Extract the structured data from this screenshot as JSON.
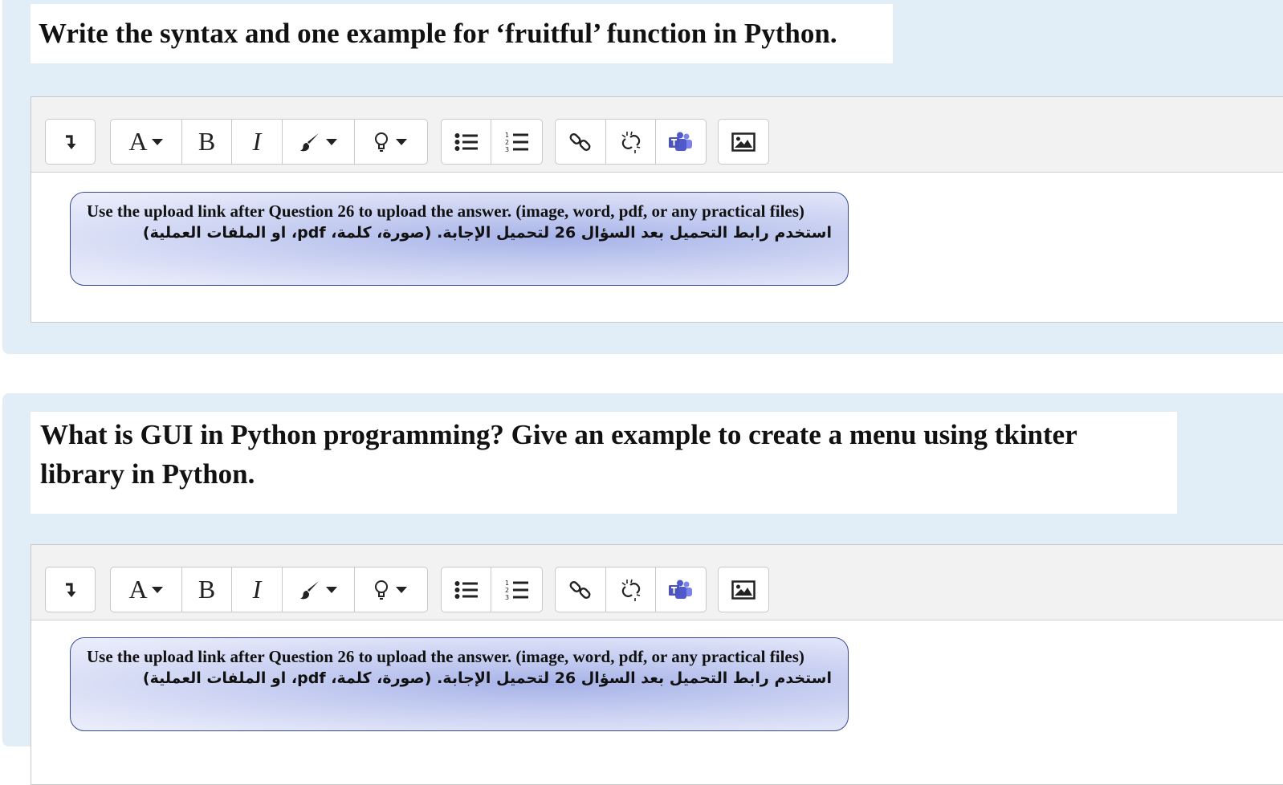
{
  "questions": [
    {
      "text": "Write the syntax and one example for ‘fruitful’ function in Python.",
      "notice": {
        "english": "Use the upload link after Question 26 to upload the answer. (image, word, pdf, or any practical files)",
        "arabic": "استخدم رابط التحميل بعد السؤال 26 لتحميل الإجابة. (صورة، كلمة، pdf، او الملفات العملية)"
      }
    },
    {
      "text": "What is GUI in Python programming?  Give an example to create a menu using tkinter library in Python.",
      "notice": {
        "english": "Use the upload link after Question 26 to upload the answer. (image, word, pdf, or any practical files)",
        "arabic": "استخدم رابط التحميل بعد السؤال 26 لتحميل الإجابة. (صورة، كلمة، pdf، او الملفات العملية)"
      }
    }
  ],
  "toolbar": {
    "font_label": "A",
    "bold_label": "B",
    "italic_label": "I",
    "icons": [
      "toggle-toolbar-icon",
      "font-family-icon",
      "bold-icon",
      "italic-icon",
      "brush-icon",
      "lightbulb-icon",
      "bullet-list-icon",
      "numbered-list-icon",
      "link-icon",
      "unlink-icon",
      "teams-icon",
      "image-icon"
    ]
  },
  "colors": {
    "panel_bg": "#e1eef7",
    "notice_border": "#3a4a96",
    "teams_purple": "#5059c9"
  }
}
